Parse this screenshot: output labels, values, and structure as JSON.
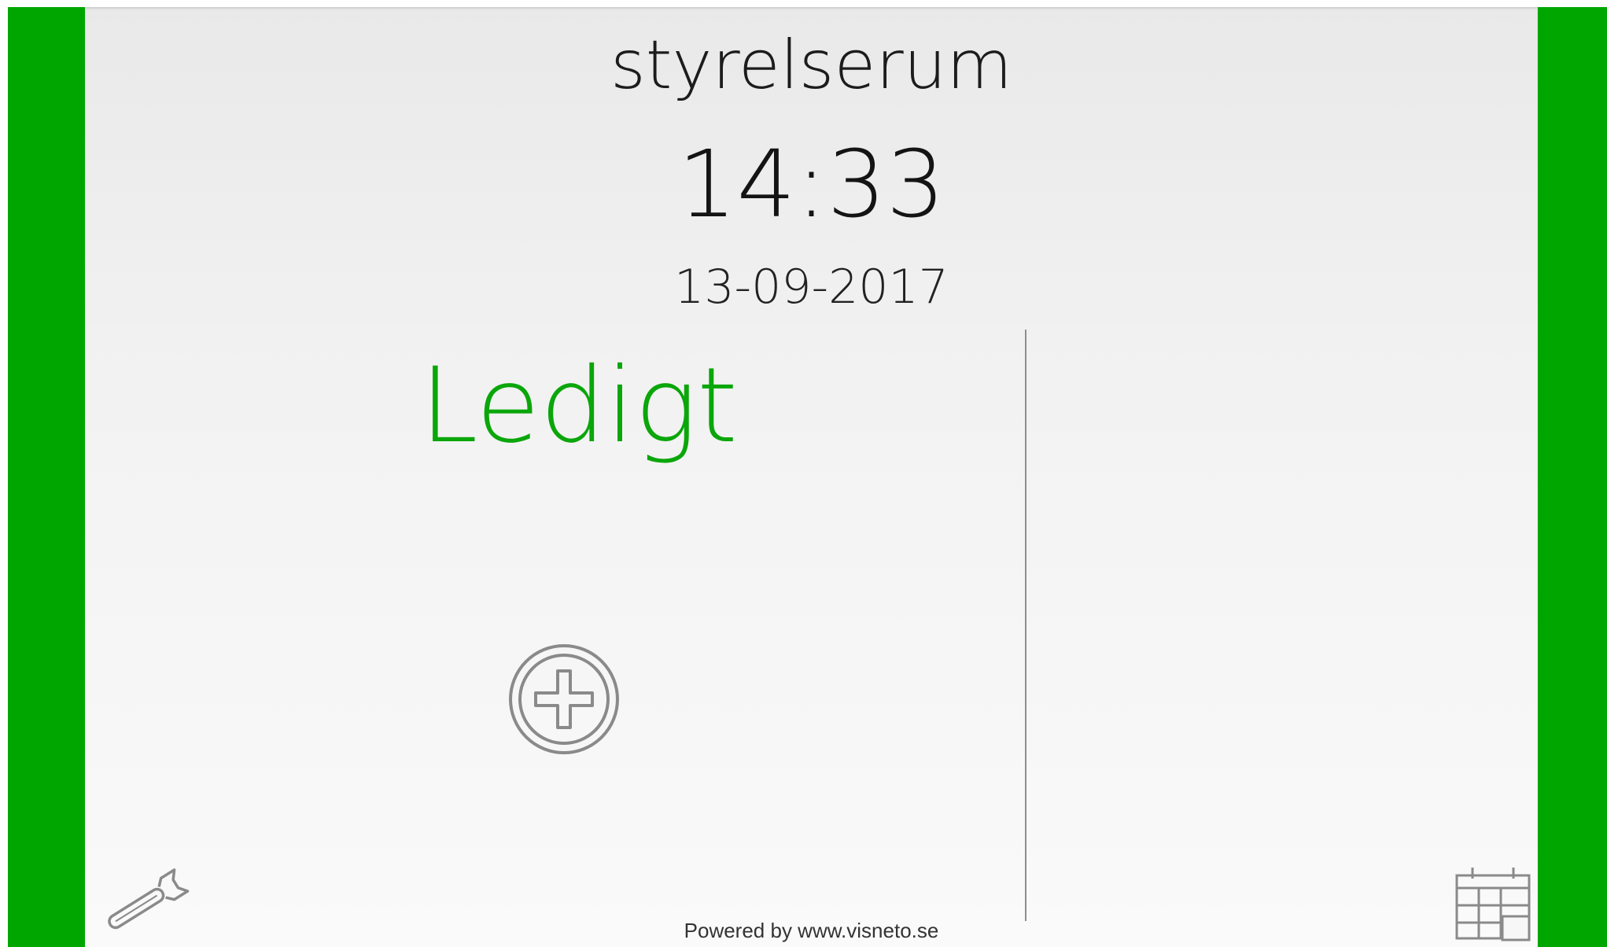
{
  "room": {
    "name": "styrelserum"
  },
  "clock": {
    "time": "14:33",
    "date": "13-09-2017"
  },
  "status": {
    "label": "Ledigt",
    "color": "#0aa60a"
  },
  "theme": {
    "frame_color": "#00a600",
    "panel_color": "#f2f2f2",
    "divider_color": "#8e8e8e",
    "icon_color": "#8a8a8a"
  },
  "icons": {
    "add": "plus-circle-icon",
    "settings": "wrench-icon",
    "calendar": "calendar-icon"
  },
  "footer": {
    "powered_by": "Powered by www.visneto.se"
  }
}
